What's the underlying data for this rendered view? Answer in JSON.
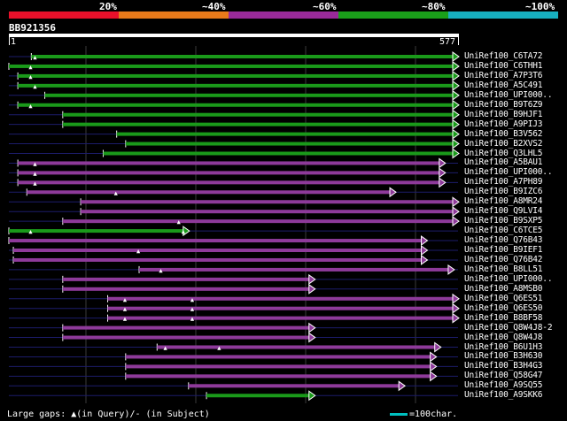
{
  "scale": {
    "labels": [
      "20%",
      "~40%",
      "~60%",
      "~80%",
      "~100%"
    ],
    "colors": [
      "#e8102a",
      "#e87a1a",
      "#9a2a9a",
      "#1aa01a",
      "#17b0c0"
    ]
  },
  "query": {
    "id": "BB921356",
    "start": "1",
    "end": "577"
  },
  "hits": [
    {
      "label": "UniRef100_C6TA72",
      "color": "green",
      "start": 0.05,
      "end": 1.0,
      "marks": [
        0.06
      ]
    },
    {
      "label": "UniRef100_C6THH1",
      "color": "green",
      "start": 0.0,
      "end": 1.0,
      "marks": [
        0.05
      ]
    },
    {
      "label": "UniRef100_A7P3T6",
      "color": "green",
      "start": 0.02,
      "end": 1.0,
      "marks": [
        0.05
      ]
    },
    {
      "label": "UniRef100_A5C491",
      "color": "green",
      "start": 0.02,
      "end": 1.0,
      "marks": [
        0.06
      ]
    },
    {
      "label": "UniRef100_UPI000..",
      "color": "green",
      "start": 0.08,
      "end": 1.0,
      "marks": []
    },
    {
      "label": "UniRef100_B9T6Z9",
      "color": "green",
      "start": 0.02,
      "end": 1.0,
      "marks": [
        0.05
      ]
    },
    {
      "label": "UniRef100_B9HJF1",
      "color": "green",
      "start": 0.12,
      "end": 1.0,
      "marks": []
    },
    {
      "label": "UniRef100_A9PIJ3",
      "color": "green",
      "start": 0.12,
      "end": 1.0,
      "marks": []
    },
    {
      "label": "UniRef100_B3V562",
      "color": "green",
      "start": 0.24,
      "end": 1.0,
      "marks": []
    },
    {
      "label": "UniRef100_B2XVS2",
      "color": "green",
      "start": 0.26,
      "end": 1.0,
      "marks": []
    },
    {
      "label": "UniRef100_Q3LHL5",
      "color": "green",
      "start": 0.21,
      "end": 1.0,
      "marks": []
    },
    {
      "label": "UniRef100_A5BAU1",
      "color": "purple",
      "start": 0.02,
      "end": 0.97,
      "marks": [
        0.06
      ]
    },
    {
      "label": "UniRef100_UPI000..",
      "color": "purple",
      "start": 0.02,
      "end": 0.97,
      "marks": [
        0.06
      ]
    },
    {
      "label": "UniRef100_A7PH89",
      "color": "purple",
      "start": 0.02,
      "end": 0.97,
      "marks": [
        0.06
      ]
    },
    {
      "label": "UniRef100_B9IZC6",
      "color": "purple",
      "start": 0.04,
      "end": 0.86,
      "marks": [
        0.24
      ]
    },
    {
      "label": "UniRef100_A8MR24",
      "color": "purple",
      "start": 0.16,
      "end": 1.0,
      "marks": []
    },
    {
      "label": "UniRef100_Q9LVI4",
      "color": "purple",
      "start": 0.16,
      "end": 1.0,
      "marks": []
    },
    {
      "label": "UniRef100_B9SXP5",
      "color": "purple",
      "start": 0.12,
      "end": 1.0,
      "marks": [
        0.38
      ]
    },
    {
      "label": "UniRef100_C6TCE5",
      "color": "green",
      "start": 0.0,
      "end": 0.4,
      "marks": [
        0.05,
        0.39
      ]
    },
    {
      "label": "UniRef100_Q76B43",
      "color": "purple",
      "start": 0.0,
      "end": 0.93,
      "marks": []
    },
    {
      "label": "UniRef100_B9IEF1",
      "color": "purple",
      "start": 0.01,
      "end": 0.93,
      "marks": [
        0.29
      ]
    },
    {
      "label": "UniRef100_Q76B42",
      "color": "purple",
      "start": 0.01,
      "end": 0.93,
      "marks": []
    },
    {
      "label": "UniRef100_B8LL51",
      "color": "purple",
      "start": 0.29,
      "end": 0.99,
      "marks": [
        0.34
      ]
    },
    {
      "label": "UniRef100_UPI000..",
      "color": "purple",
      "start": 0.12,
      "end": 0.68,
      "marks": []
    },
    {
      "label": "UniRef100_A8MSB0",
      "color": "purple",
      "start": 0.12,
      "end": 0.68,
      "marks": []
    },
    {
      "label": "UniRef100_Q6ES51",
      "color": "purple",
      "start": 0.22,
      "end": 1.0,
      "marks": [
        0.26,
        0.41
      ]
    },
    {
      "label": "UniRef100_Q6ES50",
      "color": "purple",
      "start": 0.22,
      "end": 1.0,
      "marks": [
        0.26,
        0.41
      ]
    },
    {
      "label": "UniRef100_B8BF58",
      "color": "purple",
      "start": 0.22,
      "end": 1.0,
      "marks": [
        0.26,
        0.41
      ]
    },
    {
      "label": "UniRef100_Q8W4J8-2",
      "color": "purple",
      "start": 0.12,
      "end": 0.68,
      "marks": []
    },
    {
      "label": "UniRef100_Q8W4J8",
      "color": "purple",
      "start": 0.12,
      "end": 0.68,
      "marks": []
    },
    {
      "label": "UniRef100_B6U1H3",
      "color": "purple",
      "start": 0.33,
      "end": 0.96,
      "marks": [
        0.35,
        0.47
      ]
    },
    {
      "label": "UniRef100_B3H630",
      "color": "purple",
      "start": 0.26,
      "end": 0.95,
      "marks": []
    },
    {
      "label": "UniRef100_B3H4G3",
      "color": "purple",
      "start": 0.26,
      "end": 0.95,
      "marks": []
    },
    {
      "label": "UniRef100_Q58G47",
      "color": "purple",
      "start": 0.26,
      "end": 0.95,
      "marks": []
    },
    {
      "label": "UniRef100_A9SQ55",
      "color": "purple",
      "start": 0.4,
      "end": 0.88,
      "marks": []
    },
    {
      "label": "UniRef100_A9SKK6",
      "color": "green",
      "start": 0.44,
      "end": 0.68,
      "marks": []
    }
  ],
  "colors": {
    "green": "#1a9a1a",
    "purple": "#8e3a9a",
    "line": "#1c1c6a",
    "grid": "#3a3a3a"
  },
  "footer": {
    "legend": "Large gaps: ▲(in Query)/- (in Subject)",
    "scale_label": "=100char."
  }
}
